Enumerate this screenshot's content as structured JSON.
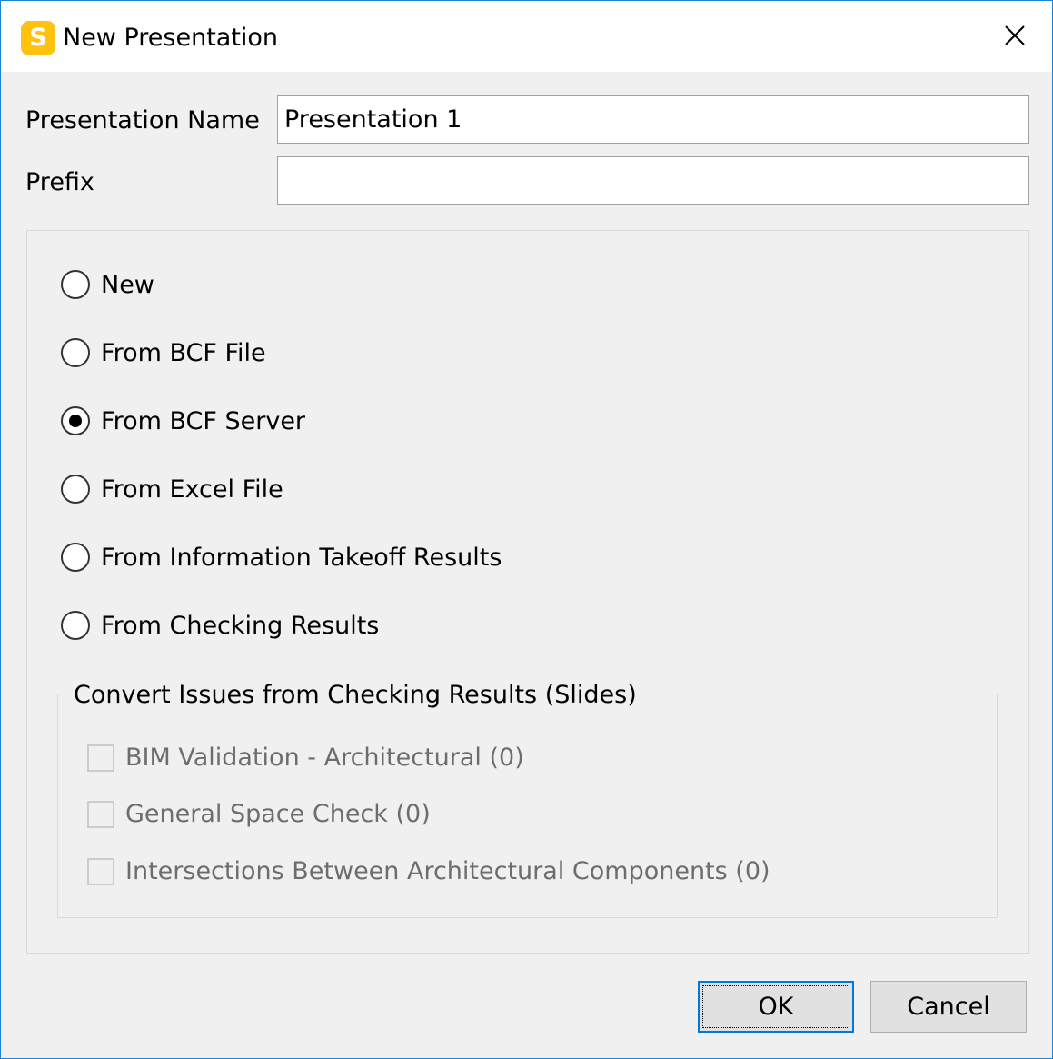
{
  "window": {
    "title": "New Presentation",
    "app_icon_letter": "S",
    "icon_name": "app-logo-icon",
    "close_icon": "close-icon"
  },
  "fields": {
    "name_label": "Presentation Name",
    "name_value": "Presentation 1",
    "prefix_label": "Prefix",
    "prefix_value": ""
  },
  "options": {
    "selected": "From BCF Server",
    "items": [
      {
        "label": "New",
        "checked": false
      },
      {
        "label": "From BCF File",
        "checked": false
      },
      {
        "label": "From BCF Server",
        "checked": true
      },
      {
        "label": "From Excel File",
        "checked": false
      },
      {
        "label": "From Information Takeoff Results",
        "checked": false
      },
      {
        "label": "From Checking Results",
        "checked": false
      }
    ]
  },
  "convert_group": {
    "title": "Convert Issues from Checking Results (Slides)",
    "items": [
      {
        "label": "BIM Validation - Architectural (0)",
        "checked": false,
        "enabled": false
      },
      {
        "label": "General Space Check (0)",
        "checked": false,
        "enabled": false
      },
      {
        "label": "Intersections Between Architectural Components (0)",
        "checked": false,
        "enabled": false
      }
    ]
  },
  "buttons": {
    "ok": "OK",
    "cancel": "Cancel"
  },
  "colors": {
    "accent": "#0078d7",
    "window_border": "#1883d7",
    "app_icon": "#ffc20e",
    "disabled_text": "#6d6d6d"
  }
}
